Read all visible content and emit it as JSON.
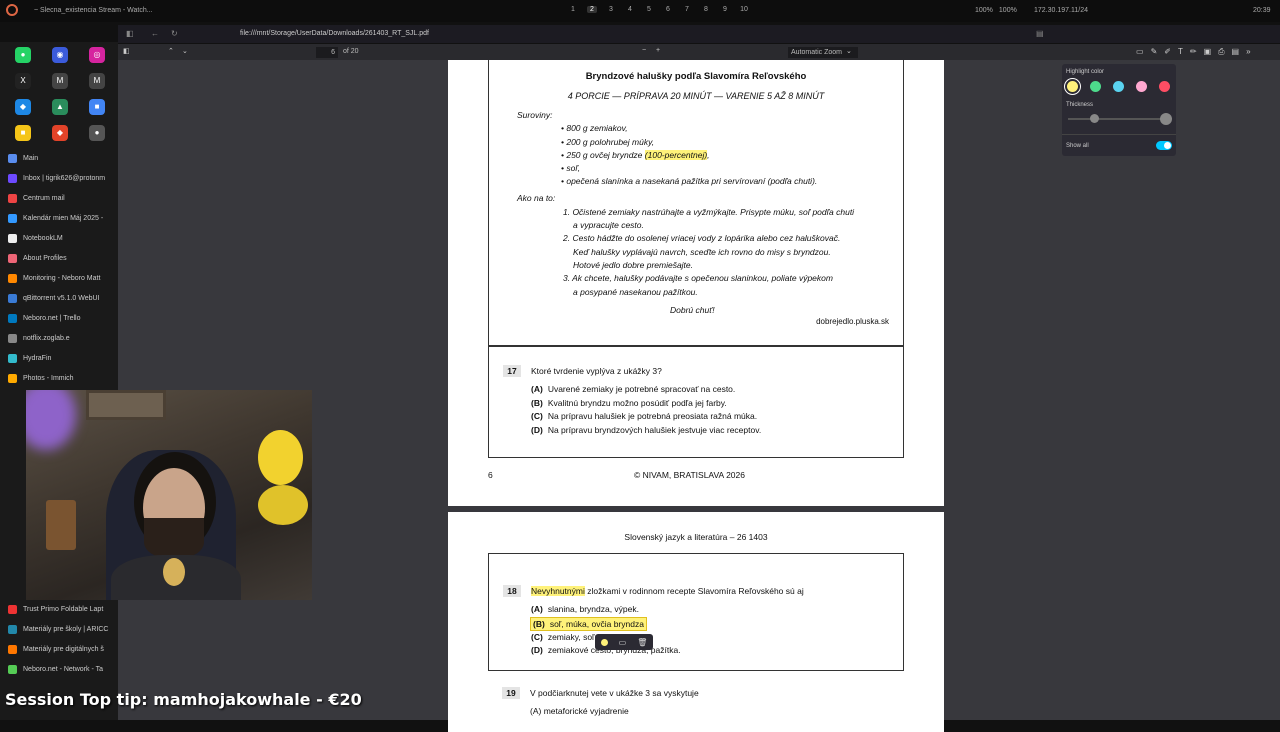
{
  "topbar": {
    "window_title": "~ Slecna_existencia Stream - Watch...",
    "workspaces": [
      "1",
      "2",
      "3",
      "4",
      "5",
      "6",
      "7",
      "8",
      "9",
      "10"
    ],
    "active_workspace": "2",
    "status": [
      "100%",
      "100%"
    ],
    "ip": "172.30.197.11/24",
    "clock": "20:39"
  },
  "browser": {
    "url": "file:///mnt/Storage/UserData/Downloads/261403_RT_SJL.pdf"
  },
  "sidebar": {
    "tiles": [
      {
        "icon": "whatsapp-icon",
        "color": "#25d366",
        "glyph": "●"
      },
      {
        "icon": "messenger-icon",
        "color": "#3b5bdb",
        "glyph": "◉"
      },
      {
        "icon": "instagram-icon",
        "color": "#d6249f",
        "glyph": "◎"
      },
      {
        "icon": "x-icon",
        "color": "#222",
        "glyph": "X"
      },
      {
        "icon": "gmail-icon",
        "color": "#444",
        "glyph": "M"
      },
      {
        "icon": "gmail-icon",
        "color": "#444",
        "glyph": "M"
      },
      {
        "icon": "chat-icon",
        "color": "#1e88e5",
        "glyph": "◆"
      },
      {
        "icon": "drive-icon",
        "color": "#2a8d5c",
        "glyph": "▲"
      },
      {
        "icon": "docs-icon",
        "color": "#4285f4",
        "glyph": "■"
      },
      {
        "icon": "notes-icon",
        "color": "#f5c518",
        "glyph": "■"
      },
      {
        "icon": "gitlab-icon",
        "color": "#e24329",
        "glyph": "◆"
      },
      {
        "icon": "github-icon",
        "color": "#555",
        "glyph": "●"
      }
    ],
    "items": [
      {
        "label": "Main",
        "color": "#5a8dee"
      },
      {
        "label": "Inbox | tigrik626@protonm",
        "color": "#6d4aff"
      },
      {
        "label": "Centrum mail",
        "color": "#e44"
      },
      {
        "label": "Kalendár mien Máj 2025 -",
        "color": "#39f"
      },
      {
        "label": "NotebookLM",
        "color": "#eee"
      },
      {
        "label": "About Profiles",
        "color": "#e67"
      },
      {
        "label": "Monitoring - Neboro Matt",
        "color": "#f80"
      },
      {
        "label": "qBittorrent v5.1.0 WebUI",
        "color": "#3a7bd5"
      },
      {
        "label": "Neboro.net | Trello",
        "color": "#0079bf"
      },
      {
        "label": "notflix.zoglab.e",
        "color": "#888"
      },
      {
        "label": "HydraFin",
        "color": "#3bc"
      },
      {
        "label": "Photos - Immich",
        "color": "#fa0"
      }
    ],
    "bottom_items": [
      {
        "label": "Trust Primo Foldable Lapt",
        "color": "#e33"
      },
      {
        "label": "Materiály pre školy | ARICC",
        "color": "#28a"
      },
      {
        "label": "Materiály pre digitálnych š",
        "color": "#f70"
      },
      {
        "label": "Neboro.net - Network - Ta",
        "color": "#5c5"
      }
    ]
  },
  "pdf_toolbar": {
    "page": "6",
    "of_pages": "of 20",
    "zoom": "Automatic Zoom"
  },
  "highlight_panel": {
    "title": "Highlight color",
    "colors": [
      "#fff27a",
      "#4ddb8c",
      "#5ad3f0",
      "#ffa8d0",
      "#ff4d64"
    ],
    "thickness_label": "Thickness",
    "show_all_label": "Show all",
    "show_all": true
  },
  "page1": {
    "recipe_title": "Bryndzové halušky podľa Slavomíra Reľovského",
    "recipe_sub": "4 PORCIE — PRÍPRAVA 20 MINÚT — VARENIE 5 AŽ 8 MINÚT",
    "ingredients_label": "Suroviny:",
    "ingredients": [
      "• 800 g zemiakov,",
      "• 200 g polohrubej múky,",
      "• 250 g ovčej bryndze",
      "• soľ,",
      "• opečená slanínka a nasekaná pažítka pri servírovaní (podľa chuti)."
    ],
    "highlighted_note": "(100-percentnej)",
    "highlighted_tail": ",",
    "method_label": "Ako na to:",
    "steps": [
      "1. Očistené zemiaky nastrúhajte a vyžmýkajte. Prisypte múku, soľ podľa chuti",
      "a vypracujte cesto.",
      "2. Cesto hádžte do osolenej vriacej vody z lopárika alebo cez haluškovač.",
      "Keď halušky vyplávajú navrch, sceďte ich rovno do misy s bryndzou.",
      "Hotové jedlo dobre premiešajte.",
      "3. Ak chcete, halušky podávajte s opečenou slaninkou, poliate výpekom",
      "a posypané nasekanou pažítkou."
    ],
    "closing": "Dobrú chuť!",
    "source": "dobrejedlo.pluska.sk",
    "q17": {
      "num": "17",
      "text": "Ktoré tvrdenie vyplýva z ukážky 3?",
      "options": [
        {
          "letter": "(A)",
          "text": "Uvarené zemiaky je potrebné spracovať na cesto."
        },
        {
          "letter": "(B)",
          "text": "Kvalitnú bryndzu možno posúdiť podľa jej farby."
        },
        {
          "letter": "(C)",
          "text": "Na prípravu halušiek je potrebná preosiata ražná múka."
        },
        {
          "letter": "(D)",
          "text": "Na prípravu bryndzových halušiek jestvuje viac receptov."
        }
      ]
    },
    "footer_page": "6",
    "footer_copy": "© NIVAM, BRATISLAVA 2026"
  },
  "page2": {
    "header": "Slovenský jazyk a literatúra – 26 1403",
    "q18": {
      "num": "18",
      "highlighted_word": "Nevyhnutnými",
      "text_rest": " zložkami v rodinnom recepte Slavomíra Reľovského sú aj",
      "options": [
        {
          "letter": "(A)",
          "text": "slanina, bryndza, výpek."
        },
        {
          "letter": "(B)",
          "text": "soľ, múka, ovčia bryndza"
        },
        {
          "letter": "(C)",
          "text": "zemiaky, soľ"
        },
        {
          "letter": "(D)",
          "text": "zemiakové cesto, bryndza, pažítka."
        }
      ]
    },
    "q19": {
      "num": "19",
      "text": "V podčiarknutej vete v ukážke 3 sa vyskytuje",
      "option_a": "(A)  metaforické vyjadrenie"
    }
  },
  "overlay": {
    "tip": "Session Top tip: mamhojakowhale - €20"
  }
}
